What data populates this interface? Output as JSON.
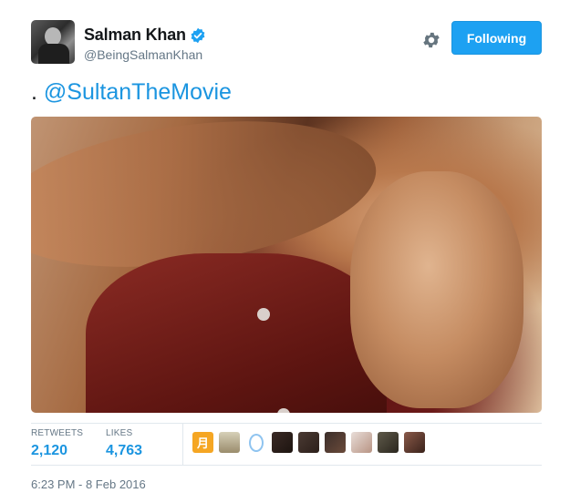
{
  "user": {
    "name": "Salman Khan",
    "handle": "@BeingSalmanKhan",
    "verified": true,
    "avatar_icon": "profile-photo"
  },
  "actions": {
    "settings_icon": "gear-icon",
    "follow_label": "Following"
  },
  "tweet": {
    "prefix": ". ",
    "mention": "@SultanTheMovie",
    "photo_icon": "tweet-photo"
  },
  "stats": {
    "retweets_label": "RETWEETS",
    "retweets_value": "2,120",
    "likes_label": "LIKES",
    "likes_value": "4,763"
  },
  "likers": {
    "first_glyph": "月"
  },
  "timestamp": "6:23 PM - 8 Feb 2016",
  "colors": {
    "accent": "#1da1f2",
    "link": "#1b95e0",
    "muted": "#657786"
  }
}
